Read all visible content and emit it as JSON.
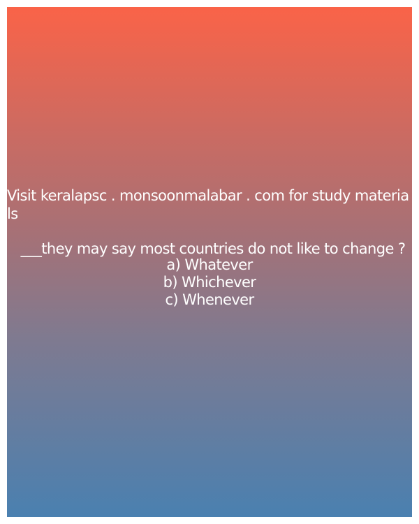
{
  "promo_text": "Visit keralapsc . monsoonmalabar . com for study materials",
  "question": {
    "text": "___they may say most countries do not like to change ?",
    "options": [
      {
        "label": "a) Whatever"
      },
      {
        "label": "b) Whichever"
      },
      {
        "label": "c) Whenever"
      }
    ]
  },
  "colors": {
    "gradient_top": "#fa6348",
    "gradient_bottom": "#4a80b0",
    "text": "#ffffff"
  }
}
